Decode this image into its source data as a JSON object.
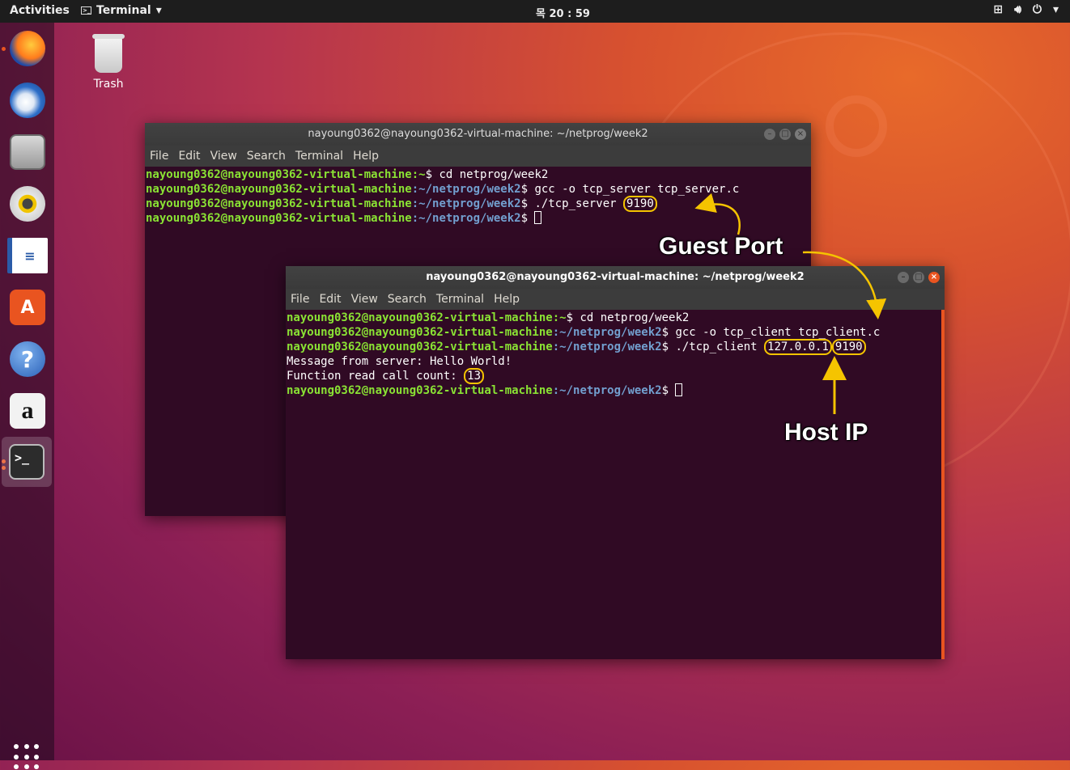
{
  "topbar": {
    "activities": "Activities",
    "app_menu": "Terminal",
    "clock": "목 20 : 59"
  },
  "desktop": {
    "trash_label": "Trash"
  },
  "dock": {
    "items": [
      {
        "icon": "firefox-icon"
      },
      {
        "icon": "thunderbird-icon"
      },
      {
        "icon": "files-icon"
      },
      {
        "icon": "rhythmbox-icon"
      },
      {
        "icon": "writer-icon"
      },
      {
        "icon": "software-center-icon"
      },
      {
        "icon": "help-icon"
      },
      {
        "icon": "amazon-icon",
        "glyph": "a"
      },
      {
        "icon": "terminal-icon",
        "glyph": ">_"
      }
    ]
  },
  "server_window": {
    "title": "nayoung0362@nayoung0362-virtual-machine: ~/netprog/week2",
    "menu": [
      "File",
      "Edit",
      "View",
      "Search",
      "Terminal",
      "Help"
    ],
    "user_host": "nayoung0362@nayoung0362-virtual-machine",
    "lines": [
      {
        "path": ":~",
        "cmd": "$ cd netprog/week2"
      },
      {
        "path": ":~/netprog/week2",
        "cmd": "$ gcc -o tcp_server tcp_server.c"
      },
      {
        "path": ":~/netprog/week2",
        "cmd": "$ ./tcp_server ",
        "arg": "9190"
      },
      {
        "path": ":~/netprog/week2",
        "cmd": "$ "
      }
    ]
  },
  "client_window": {
    "title": "nayoung0362@nayoung0362-virtual-machine: ~/netprog/week2",
    "menu": [
      "File",
      "Edit",
      "View",
      "Search",
      "Terminal",
      "Help"
    ],
    "user_host": "nayoung0362@nayoung0362-virtual-machine",
    "lines": [
      {
        "path": ":~",
        "cmd": "$ cd netprog/week2"
      },
      {
        "path": ":~/netprog/week2",
        "cmd": "$ gcc -o tcp_client tcp_client.c"
      },
      {
        "path": ":~/netprog/week2",
        "cmd": "$ ./tcp_client ",
        "arg1": "127.0.0.1",
        "arg2": "9190"
      }
    ],
    "output1": "Message from server: Hello World!",
    "output2_label": "Function read call count: ",
    "output2_value": "13",
    "last_prompt_path": ":~/netprog/week2",
    "last_prompt_cmd": "$ "
  },
  "annotations": {
    "guest_port": "Guest Port",
    "host_ip": "Host IP",
    "highlight_color": "#f5c400"
  }
}
